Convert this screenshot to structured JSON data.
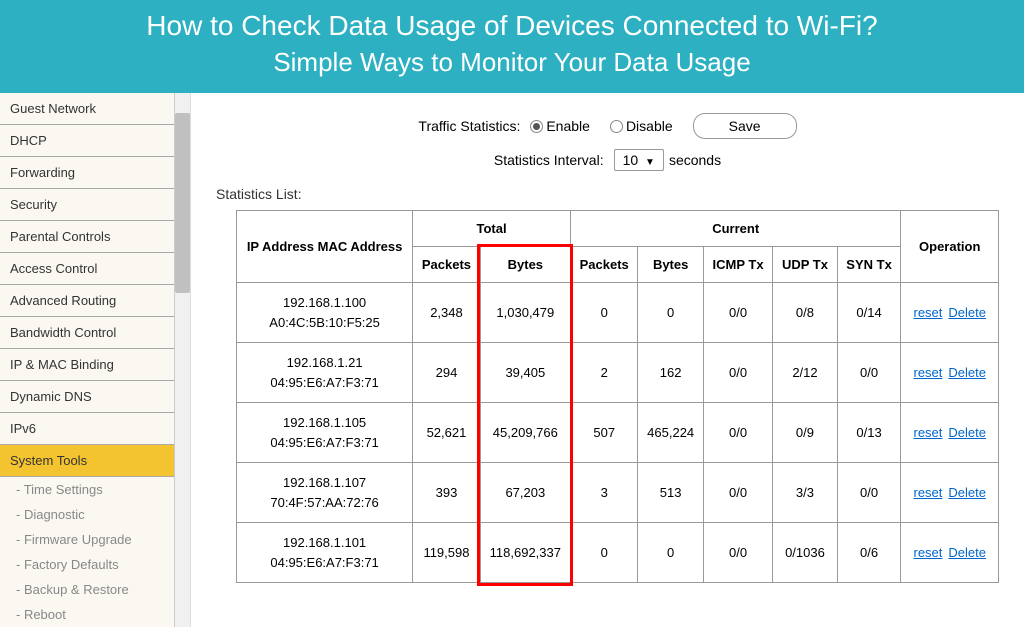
{
  "header": {
    "title": "How to Check Data Usage of Devices Connected to Wi-Fi?",
    "subtitle": "Simple Ways to Monitor Your Data Usage"
  },
  "sidebar": {
    "items": [
      {
        "label": "Guest Network"
      },
      {
        "label": "DHCP"
      },
      {
        "label": "Forwarding"
      },
      {
        "label": "Security"
      },
      {
        "label": "Parental Controls"
      },
      {
        "label": "Access Control"
      },
      {
        "label": "Advanced Routing"
      },
      {
        "label": "Bandwidth Control"
      },
      {
        "label": "IP & MAC Binding"
      },
      {
        "label": "Dynamic DNS"
      },
      {
        "label": "IPv6"
      },
      {
        "label": "System Tools"
      }
    ],
    "subs": [
      {
        "label": "- Time Settings"
      },
      {
        "label": "- Diagnostic"
      },
      {
        "label": "- Firmware Upgrade"
      },
      {
        "label": "- Factory Defaults"
      },
      {
        "label": "- Backup & Restore"
      },
      {
        "label": "- Reboot"
      }
    ]
  },
  "controls": {
    "traffic_label": "Traffic Statistics:",
    "enable": "Enable",
    "disable": "Disable",
    "save": "Save",
    "interval_label": "Statistics Interval:",
    "interval_value": "10",
    "seconds": "seconds"
  },
  "stats_label": "Statistics List:",
  "table": {
    "headers": {
      "ip_mac": "IP Address MAC Address",
      "total": "Total",
      "current": "Current",
      "packets": "Packets",
      "bytes": "Bytes",
      "icmp": "ICMP Tx",
      "udp": "UDP Tx",
      "syn": "SYN Tx",
      "operation": "Operation"
    },
    "rows": [
      {
        "ip": "192.168.1.100",
        "mac": "A0:4C:5B:10:F5:25",
        "t_packets": "2,348",
        "t_bytes": "1,030,479",
        "c_packets": "0",
        "c_bytes": "0",
        "icmp": "0/0",
        "udp": "0/8",
        "syn": "0/14"
      },
      {
        "ip": "192.168.1.21",
        "mac": "04:95:E6:A7:F3:71",
        "t_packets": "294",
        "t_bytes": "39,405",
        "c_packets": "2",
        "c_bytes": "162",
        "icmp": "0/0",
        "udp": "2/12",
        "syn": "0/0"
      },
      {
        "ip": "192.168.1.105",
        "mac": "04:95:E6:A7:F3:71",
        "t_packets": "52,621",
        "t_bytes": "45,209,766",
        "c_packets": "507",
        "c_bytes": "465,224",
        "icmp": "0/0",
        "udp": "0/9",
        "syn": "0/13"
      },
      {
        "ip": "192.168.1.107",
        "mac": "70:4F:57:AA:72:76",
        "t_packets": "393",
        "t_bytes": "67,203",
        "c_packets": "3",
        "c_bytes": "513",
        "icmp": "0/0",
        "udp": "3/3",
        "syn": "0/0"
      },
      {
        "ip": "192.168.1.101",
        "mac": "04:95:E6:A7:F3:71",
        "t_packets": "119,598",
        "t_bytes": "118,692,337",
        "c_packets": "0",
        "c_bytes": "0",
        "icmp": "0/0",
        "udp": "0/1036",
        "syn": "0/6"
      }
    ],
    "reset": "reset",
    "delete": "Delete"
  }
}
